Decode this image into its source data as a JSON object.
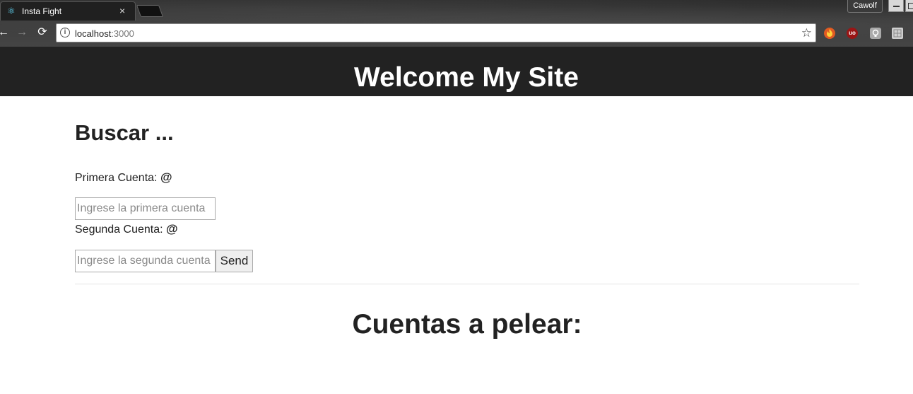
{
  "browser": {
    "tab": {
      "title": "Insta Fight",
      "favicon": "react-icon",
      "close": "×"
    },
    "profile": "Cawolf",
    "nav": {
      "back": "←",
      "forward": "→",
      "reload": "⟳"
    },
    "address": {
      "host": "localhost",
      "port": ":3000",
      "info": "i",
      "star": "☆"
    },
    "extensions": [
      {
        "name": "fire-extension-icon",
        "glyph": ""
      },
      {
        "name": "ublock-icon",
        "glyph": "uo"
      },
      {
        "name": "lightbulb-extension-icon",
        "glyph": ""
      },
      {
        "name": "puzzle-extension-icon",
        "glyph": ""
      }
    ]
  },
  "site": {
    "header_title": "Welcome My Site",
    "search_heading": "Buscar ...",
    "first_label": "Primera Cuenta:",
    "second_label": "Segunda Cuenta:",
    "at_symbol": "@",
    "first_placeholder": "Ingrese la primera cuenta",
    "second_placeholder": "Ingrese la segunda cuenta",
    "send_label": "Send",
    "fight_heading": "Cuentas a pelear:"
  },
  "colors": {
    "header_bg": "#222222",
    "text": "#222222"
  }
}
